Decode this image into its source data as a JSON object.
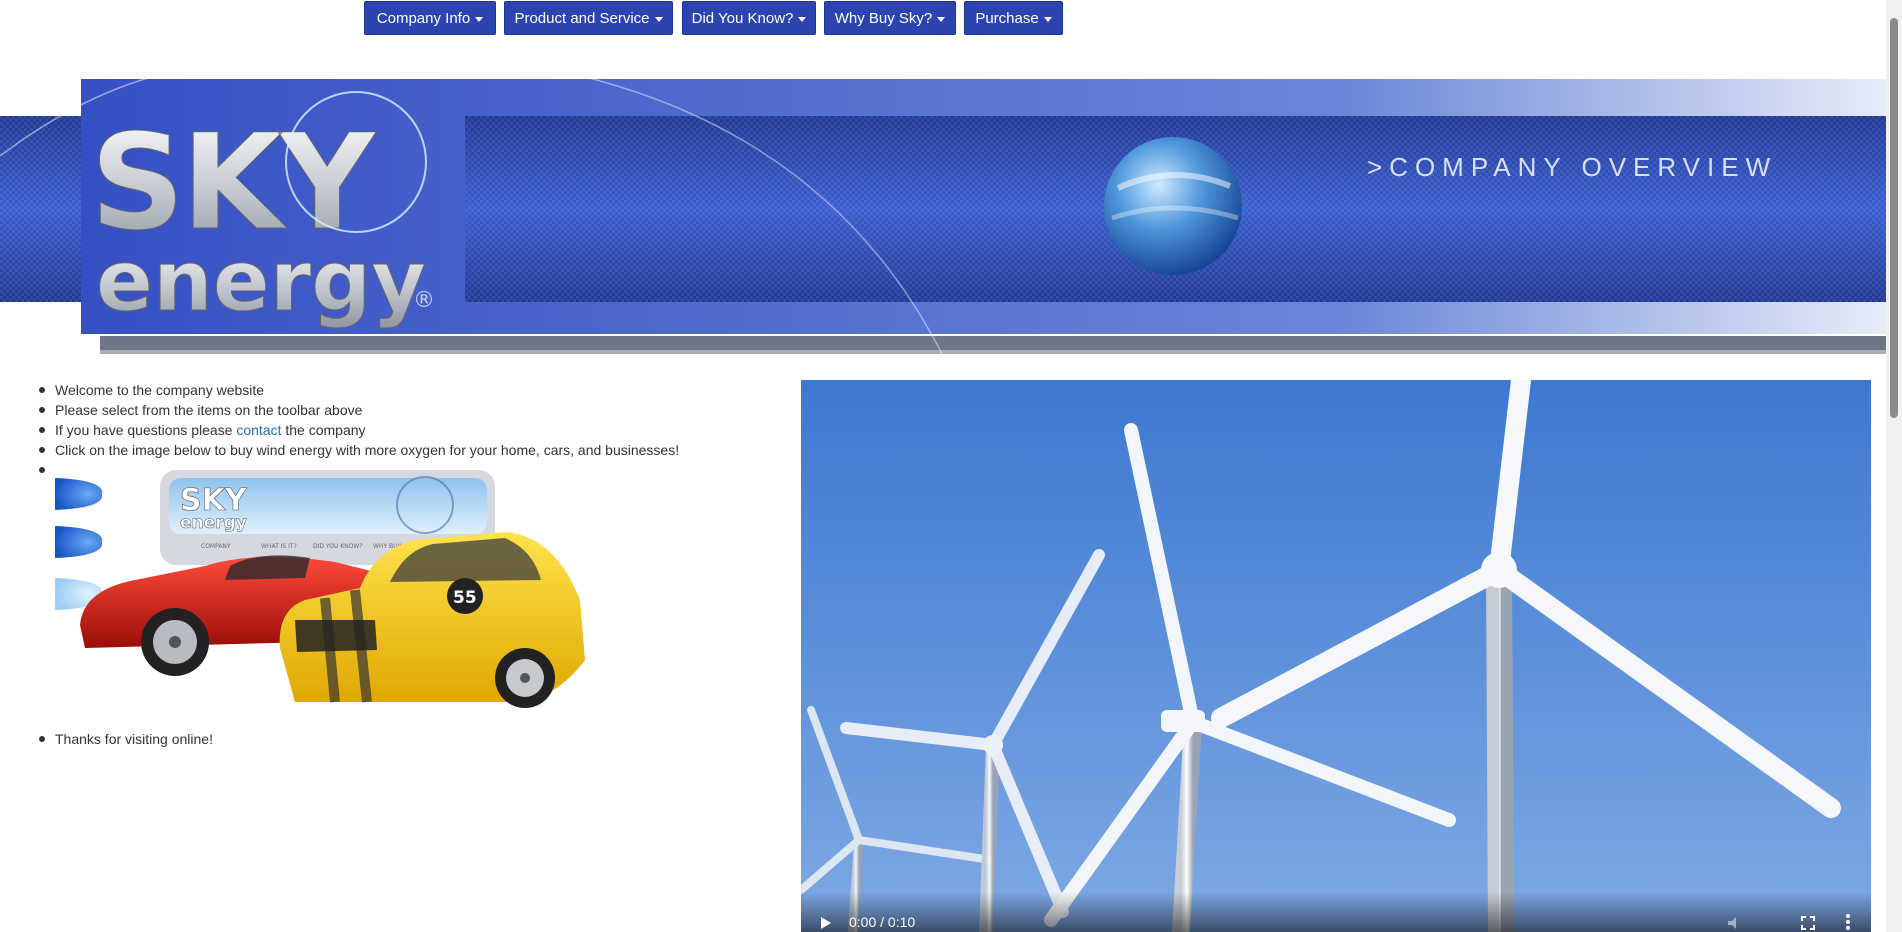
{
  "nav": {
    "items": [
      {
        "label": "Company Info",
        "has_dropdown": true
      },
      {
        "label": "Product and Service",
        "has_dropdown": true
      },
      {
        "label": "Did You Know?",
        "has_dropdown": true
      },
      {
        "label": "Why Buy Sky?",
        "has_dropdown": true
      },
      {
        "label": "Purchase",
        "has_dropdown": true
      }
    ]
  },
  "banner": {
    "logo_line1": "SKY",
    "logo_line2": "energy",
    "registered": "®",
    "tagline": ">COMPANY OVERVIEW"
  },
  "content": {
    "bullets": {
      "welcome": "Welcome to the company website",
      "select": "Please select from the items on the toolbar above",
      "questions_before": "If you have questions please ",
      "questions_link": "contact",
      "questions_after": " the company",
      "click": "Click on the image below to buy wind energy with more oxygen for your home, cars, and businesses!",
      "thanks": "Thanks for visiting online!"
    },
    "promo_image": {
      "logo_line1": "SKY",
      "logo_line2": "energy",
      "menu": [
        "COMPANY",
        "WHAT IS IT?",
        "DID YOU KNOW?",
        "WHY BUY SKY?"
      ],
      "car_number": "55"
    }
  },
  "video": {
    "time": "0:00 / 0:10",
    "icons": [
      "play-icon",
      "volume-icon",
      "fullscreen-icon",
      "more-options-icon"
    ]
  },
  "colors": {
    "nav_bg": "#2c44b0",
    "banner_blue": "#3550c4",
    "link": "#2e6dad",
    "sky": "#5a8ed6"
  }
}
